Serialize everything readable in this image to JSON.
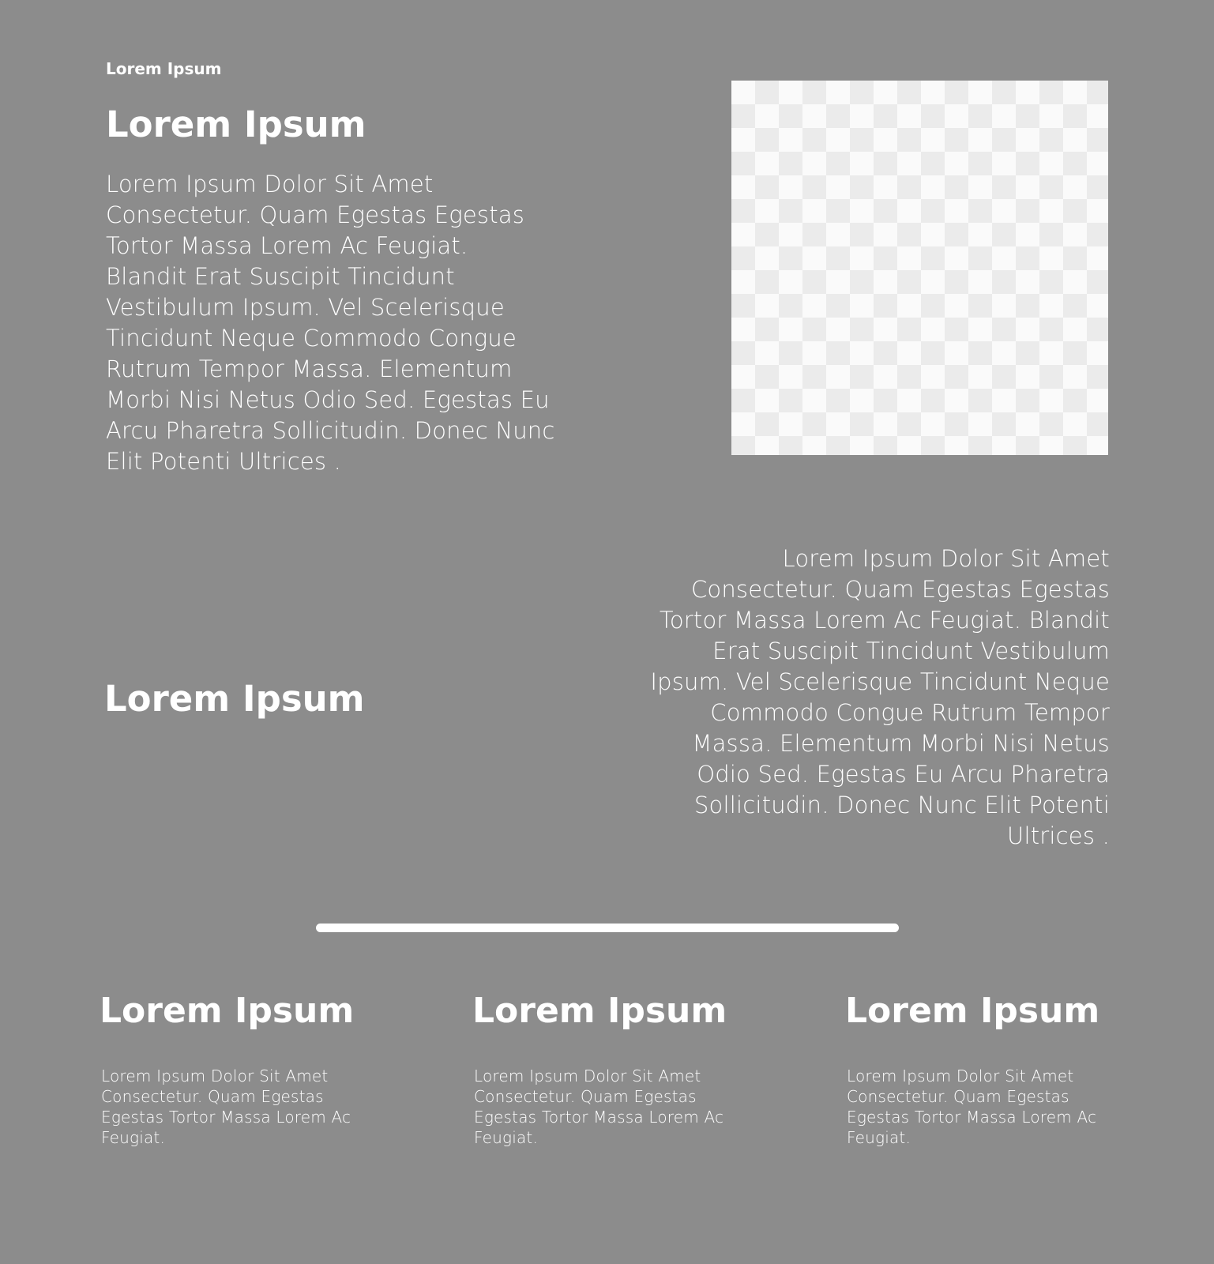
{
  "intro": {
    "eyebrow": "Lorem Ipsum",
    "title": "Lorem Ipsum",
    "body_lines": [
      "Lorem Ipsum Dolor Sit Amet",
      "Consectetur. Quam Egestas Egestas",
      "Tortor Massa Lorem Ac Feugiat.",
      "Blandit Erat Suscipit Tincidunt",
      "Vestibulum Ipsum. Vel Scelerisque",
      "Tincidunt Neque Commodo Congue",
      "Rutrum Tempor Massa. Elementum",
      "Morbi Nisi Netus Odio Sed. Egestas Eu",
      "Arcu Pharetra Sollicitudin. Donec Nunc",
      "Elit Potenti Ultrices ."
    ]
  },
  "feature": {
    "title": "Lorem Ipsum",
    "body_lines": [
      "Lorem Ipsum Dolor Sit Amet",
      "Consectetur. Quam Egestas Egestas",
      "Tortor Massa Lorem Ac Feugiat. Blandit",
      "Erat Suscipit Tincidunt Vestibulum",
      "Ipsum. Vel Scelerisque Tincidunt Neque",
      "Commodo Congue Rutrum Tempor",
      "Massa. Elementum Morbi Nisi Netus",
      "Odio Sed. Egestas Eu Arcu Pharetra",
      "Sollicitudin. Donec Nunc Elit Potenti",
      "Ultrices ."
    ]
  },
  "columns": [
    {
      "title": "Lorem Ipsum",
      "text_lines": [
        "Lorem Ipsum Dolor Sit Amet",
        "Consectetur. Quam Egestas",
        "Egestas Tortor Massa Lorem Ac",
        "Feugiat."
      ]
    },
    {
      "title": "Lorem Ipsum",
      "text_lines": [
        "Lorem Ipsum Dolor Sit Amet",
        "Consectetur. Quam Egestas",
        "Egestas Tortor Massa Lorem Ac",
        "Feugiat."
      ]
    },
    {
      "title": "Lorem Ipsum",
      "text_lines": [
        "Lorem Ipsum Dolor Sit Amet",
        "Consectetur. Quam Egestas",
        "Egestas Tortor Massa Lorem Ac",
        "Feugiat."
      ]
    }
  ],
  "colors": {
    "background": "#8c8c8c",
    "text": "#ffffff",
    "checker_light": "#fafafa",
    "checker_dark": "#ebebeb"
  }
}
